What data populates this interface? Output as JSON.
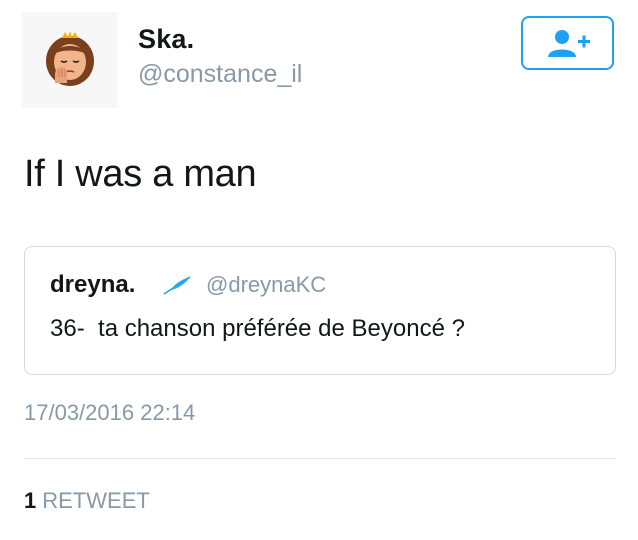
{
  "author": {
    "display_name": "Ska.",
    "handle": "@constance_il",
    "avatar_icon": "woman-facepalm-emoji"
  },
  "follow_button": {
    "icon": "add-user-icon",
    "accent_color": "#1da1f2"
  },
  "tweet": {
    "text": "If I was a man"
  },
  "quoted_tweet": {
    "display_name": "dreyna.",
    "badge_icon": "feather-icon",
    "handle": "@dreynaKC",
    "text": "36-  ta chanson préférée de Beyoncé ?"
  },
  "timestamp": "17/03/2016 22:14",
  "stats": {
    "retweet_count": "1",
    "retweet_label": "RETWEET"
  }
}
